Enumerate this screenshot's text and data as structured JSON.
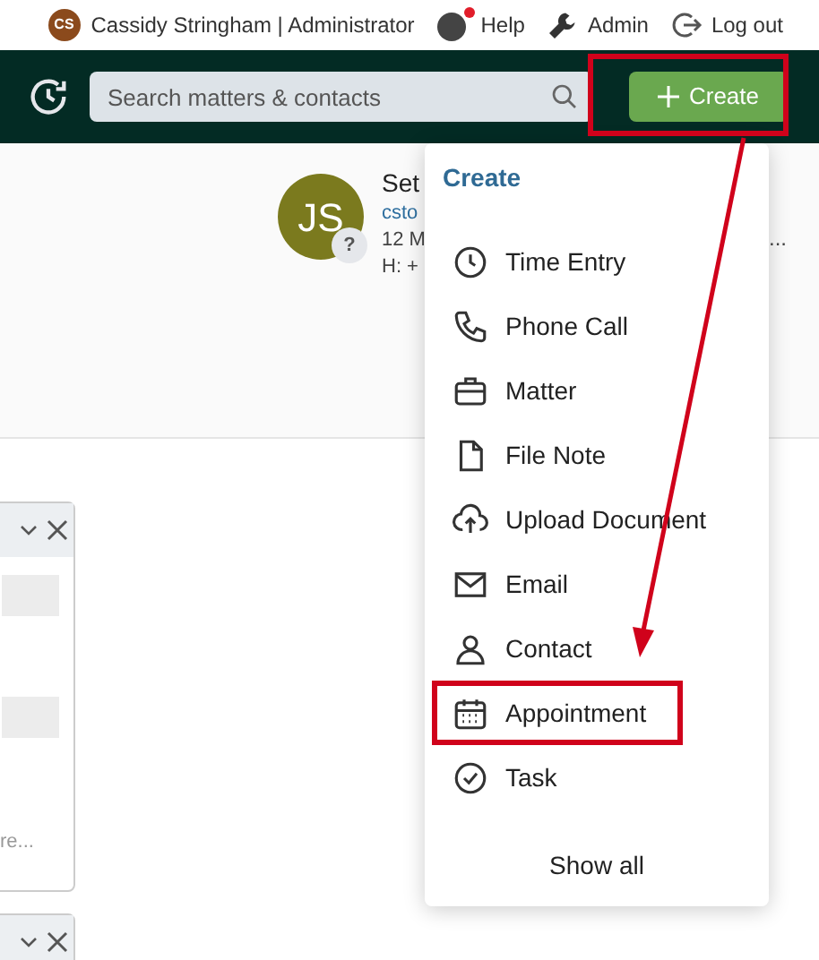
{
  "top_bar": {
    "user_initials": "CS",
    "user_label": "Cassidy Stringham | Administrator",
    "links": [
      {
        "kind": "help",
        "label": "Help",
        "alert": true
      },
      {
        "kind": "admin",
        "label": "Admin"
      },
      {
        "kind": "logout",
        "label": "Log out"
      }
    ]
  },
  "header": {
    "search": {
      "placeholder": "Search matters & contacts"
    },
    "create_button": {
      "label": "Create",
      "highlighted": true
    }
  },
  "profile": {
    "initials": "JS",
    "badge": "?",
    "lines": [
      "Set",
      "csto",
      "12 M",
      "H: +"
    ],
    "overflow": "..."
  },
  "panels": [
    {
      "kind": "full",
      "more": "re..."
    },
    {
      "kind": "cut"
    }
  ],
  "create_menu": {
    "title": "Create",
    "items": [
      {
        "kind": "clock",
        "label": "Time Entry",
        "highlighted": false
      },
      {
        "kind": "phone",
        "label": "Phone Call",
        "highlighted": false
      },
      {
        "kind": "briefcase",
        "label": "Matter",
        "highlighted": false
      },
      {
        "kind": "file",
        "label": "File Note",
        "highlighted": false
      },
      {
        "kind": "upload",
        "label": "Upload Document",
        "highlighted": false
      },
      {
        "kind": "mail",
        "label": "Email",
        "highlighted": false
      },
      {
        "kind": "person",
        "label": "Contact",
        "highlighted": false
      },
      {
        "kind": "calendar",
        "label": "Appointment",
        "highlighted": true
      },
      {
        "kind": "check",
        "label": "Task",
        "highlighted": false
      }
    ],
    "footer": "Show all"
  }
}
